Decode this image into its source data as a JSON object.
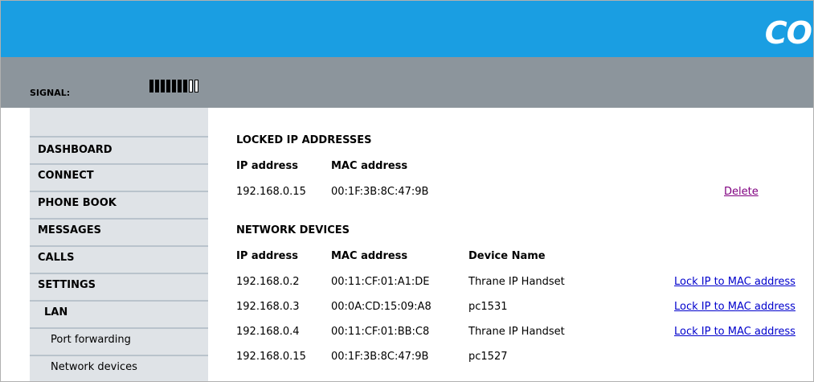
{
  "header": {
    "logo_text": "CO"
  },
  "status": {
    "signal_label": "SIGNAL:",
    "signal_level": 7,
    "signal_max": 9
  },
  "sidebar": {
    "items": [
      {
        "label": "DASHBOARD"
      },
      {
        "label": "CONNECT"
      },
      {
        "label": "PHONE BOOK"
      },
      {
        "label": "MESSAGES"
      },
      {
        "label": "CALLS"
      },
      {
        "label": "SETTINGS"
      },
      {
        "label": "LAN"
      },
      {
        "label": "Port forwarding"
      },
      {
        "label": "Network devices"
      }
    ]
  },
  "locked": {
    "title": "LOCKED IP ADDRESSES",
    "col_ip": "IP address",
    "col_mac": "MAC address",
    "rows": [
      {
        "ip": "192.168.0.15",
        "mac": "00:1F:3B:8C:47:9B",
        "action": "Delete"
      }
    ]
  },
  "devices": {
    "title": "NETWORK DEVICES",
    "col_ip": "IP address",
    "col_mac": "MAC address",
    "col_name": "Device Name",
    "rows": [
      {
        "ip": "192.168.0.2",
        "mac": "00:11:CF:01:A1:DE",
        "name": "Thrane IP Handset",
        "action": "Lock IP to MAC address"
      },
      {
        "ip": "192.168.0.3",
        "mac": "00:0A:CD:15:09:A8",
        "name": "pc1531",
        "action": "Lock IP to MAC address"
      },
      {
        "ip": "192.168.0.4",
        "mac": "00:11:CF:01:BB:C8",
        "name": "Thrane IP Handset",
        "action": "Lock IP to MAC address"
      },
      {
        "ip": "192.168.0.15",
        "mac": "00:1F:3B:8C:47:9B",
        "name": "pc1527",
        "action": ""
      }
    ]
  }
}
